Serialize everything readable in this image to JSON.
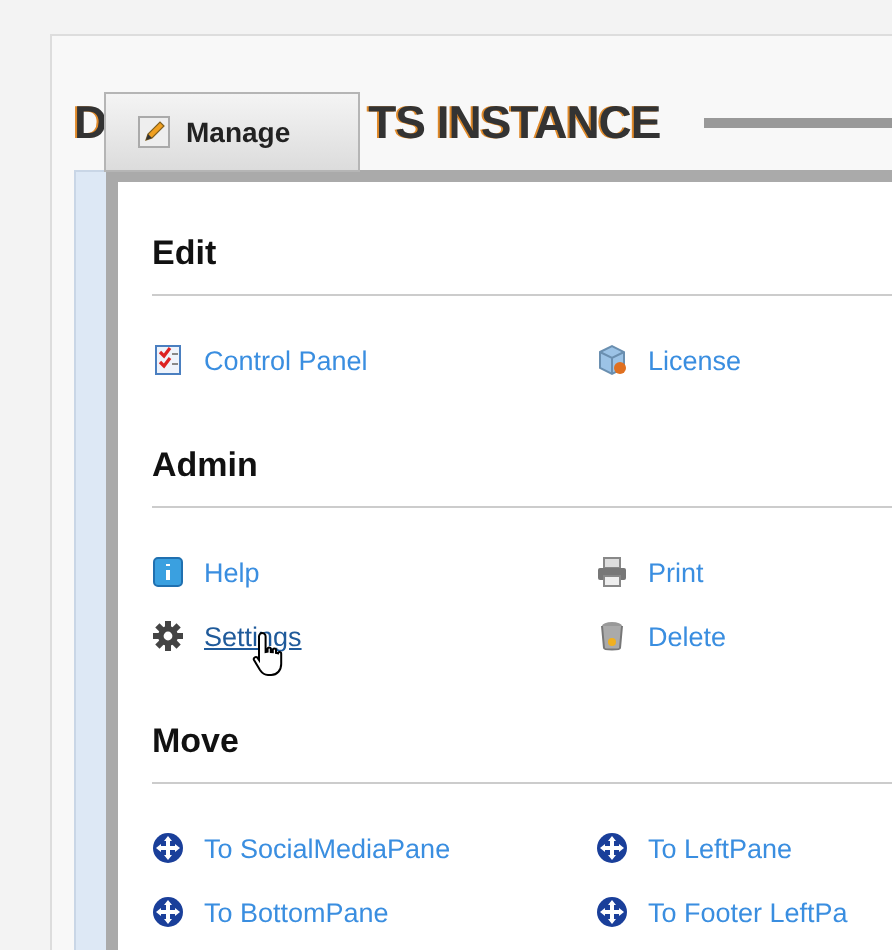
{
  "module": {
    "title_parts": [
      "D",
      "TS INSTANCE"
    ]
  },
  "manage_button": {
    "label": "Manage"
  },
  "menu": {
    "sections": [
      {
        "heading": "Edit",
        "items": [
          {
            "label": "Control Panel",
            "kind": "checklist",
            "hovered": false
          },
          {
            "label": "License",
            "kind": "package",
            "hovered": false
          }
        ]
      },
      {
        "heading": "Admin",
        "items": [
          {
            "label": "Help",
            "kind": "info",
            "hovered": false
          },
          {
            "label": "Print",
            "kind": "printer",
            "hovered": false
          },
          {
            "label": "Settings",
            "kind": "gear",
            "hovered": true
          },
          {
            "label": "Delete",
            "kind": "trash",
            "hovered": false
          }
        ]
      },
      {
        "heading": "Move",
        "items": [
          {
            "label": "To SocialMediaPane",
            "kind": "move",
            "hovered": false
          },
          {
            "label": "To LeftPane",
            "kind": "move",
            "hovered": false
          },
          {
            "label": "To BottomPane",
            "kind": "move",
            "hovered": false
          },
          {
            "label": "To Footer LeftPa",
            "kind": "move",
            "hovered": false
          }
        ]
      }
    ]
  }
}
